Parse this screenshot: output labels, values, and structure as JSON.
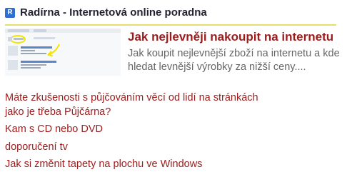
{
  "header": {
    "logo_letter": "R",
    "title": "Radírna - Internetová online poradna"
  },
  "featured": {
    "title": "Jak nejlevněji nakoupit na internetu",
    "description": "Jak koupit nejlevnější zboží na internetu a kde hledat levnější výrobky za nižší ceny....",
    "thumbnail_icon": "search-results-screenshot-icon"
  },
  "links": [
    {
      "label": "Máte zkušenosti s půjčováním věcí od lidí na stránkách jako je třeba Půjčárna?"
    },
    {
      "label": "Kam s CD nebo DVD"
    },
    {
      "label": "doporučení tv"
    },
    {
      "label": "Jak si změnit tapety na plochu ve Windows"
    }
  ],
  "colors": {
    "link": "#9c1c1c",
    "header_underline": "#e6dd6a",
    "logo": "#2f6fd1",
    "description": "#666666"
  }
}
